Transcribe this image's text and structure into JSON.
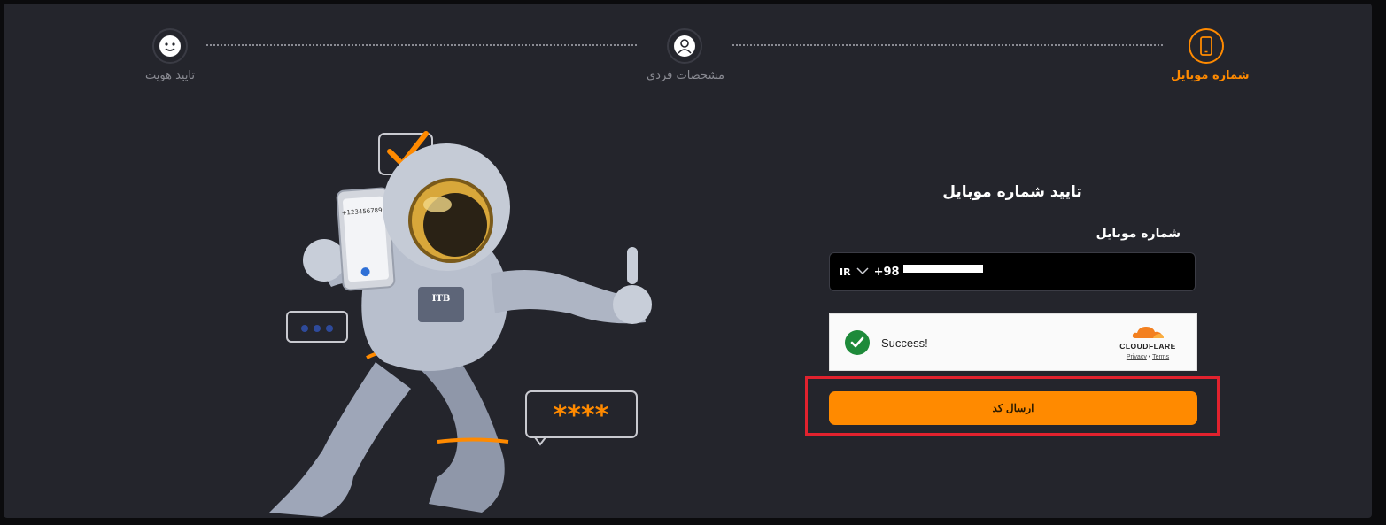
{
  "stepper": {
    "steps": [
      {
        "label": "شماره موبایل",
        "icon": "mobile-phone-icon",
        "active": true
      },
      {
        "label": "مشخصات فردی",
        "icon": "user-icon",
        "active": false
      },
      {
        "label": "تایید هویت",
        "icon": "face-id-icon",
        "active": false
      }
    ]
  },
  "form": {
    "title": "تایید شماره موبایل",
    "phone_label": "شماره موبایل",
    "country_code": "IR",
    "dial_code": "+98",
    "phone_value": ""
  },
  "captcha": {
    "status": "Success!",
    "brand": "CLOUDFLARE",
    "privacy": "Privacy",
    "separator": "•",
    "terms": "Terms"
  },
  "submit": {
    "label": "ارسال کد"
  },
  "illustration": {
    "phone_screen_number": "+1234567890",
    "password_bubble": "****",
    "suit_badge": "ITB"
  },
  "colors": {
    "accent": "#ff8a00",
    "background": "#24252c",
    "success": "#1e8a3a",
    "highlight": "#e1222e"
  }
}
